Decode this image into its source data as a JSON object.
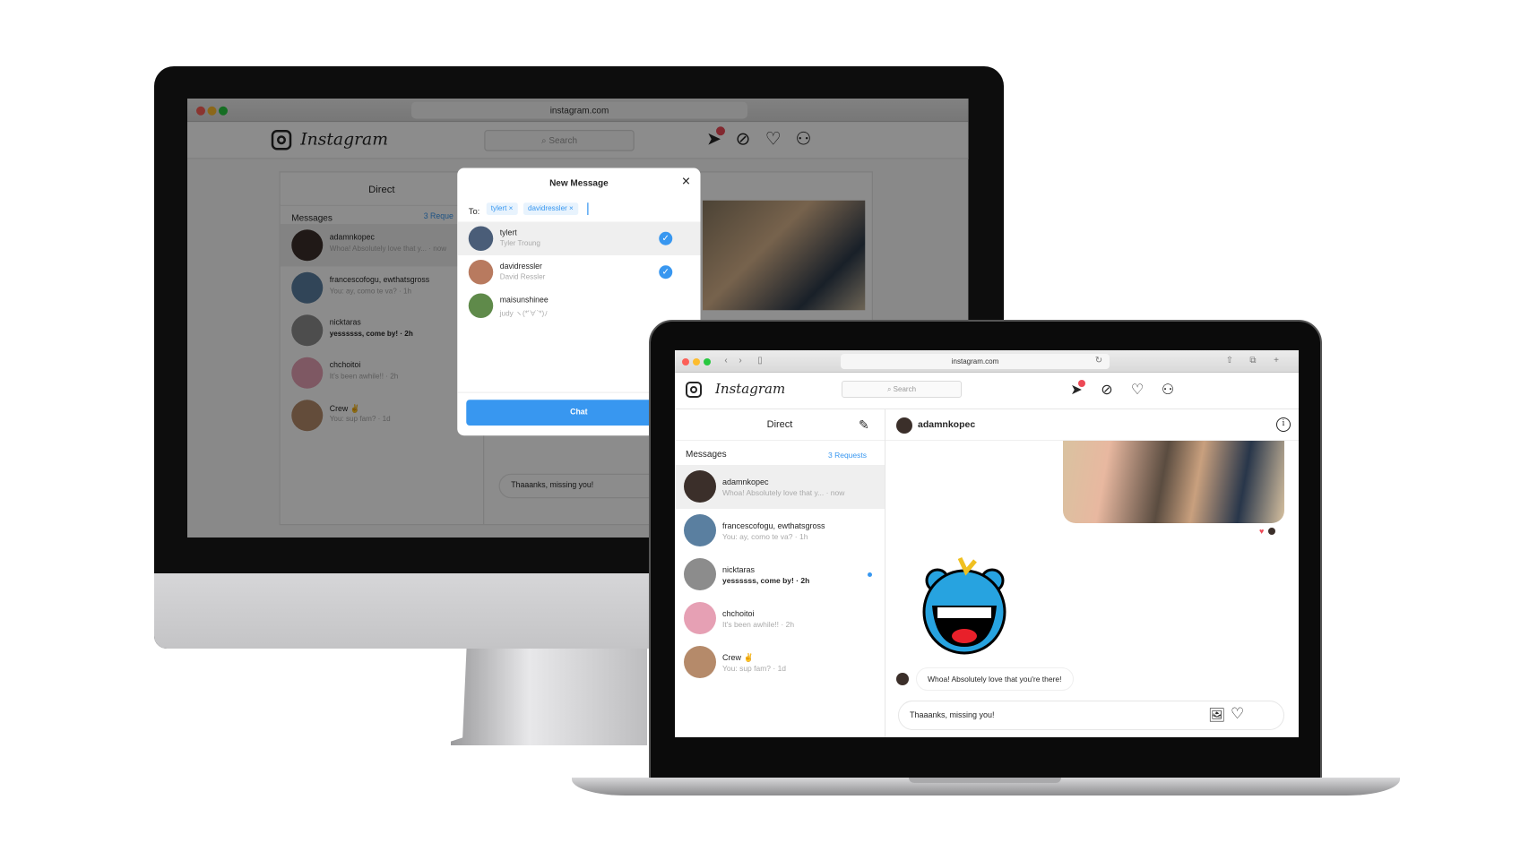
{
  "browser": {
    "url": "instagram.com"
  },
  "app": {
    "wordmark": "Instagram",
    "search_placeholder": "Search",
    "direct_title": "Direct",
    "messages_label": "Messages",
    "requests": "3 Requests",
    "requests_truncated": "3 Reque"
  },
  "threads": [
    {
      "name": "adamnkopec",
      "preview": "Whoa! Absolutely love that y... · now",
      "bold": false,
      "color": "#3b2f2a"
    },
    {
      "name": "francescofogu, ewthatsgross",
      "preview": "You: ay, como te va? · 1h",
      "bold": false,
      "color": "#5a7fa0"
    },
    {
      "name": "nicktaras",
      "preview": "yessssss, come by! · 2h",
      "bold": true,
      "unread": true,
      "color": "#8c8c8c"
    },
    {
      "name": "chchoitoi",
      "preview": "It's been awhile!! · 2h",
      "bold": false,
      "color": "#e6a0b4"
    },
    {
      "name": "Crew ✌",
      "preview": "You: sup fam? · 1d",
      "bold": false,
      "color": "#b58a6a"
    }
  ],
  "chat": {
    "username": "adamnkopec",
    "incoming_message": "Whoa! Absolutely love that you're there!",
    "composer_value": "Thaaanks, missing you!"
  },
  "modal": {
    "title": "New Message",
    "to_label": "To:",
    "chips": [
      "tylert ×",
      "davidressler ×"
    ],
    "suggestions": [
      {
        "username": "tylert",
        "fullname": "Tyler Troung",
        "selected": true,
        "color": "#4a5d78"
      },
      {
        "username": "davidressler",
        "fullname": "David Ressler",
        "selected": true,
        "color": "#b87a5f"
      },
      {
        "username": "maisunshinee",
        "fullname": "judy ヽ(*'∀`*)ﾉ",
        "selected": false,
        "color": "#5f8a4a"
      }
    ],
    "chat_button": "Chat"
  },
  "colors": {
    "accent": "#3897f0",
    "badge": "#ed4956"
  },
  "icons": [
    "direct-icon",
    "compass-icon",
    "heart-icon",
    "profile-icon",
    "compose-icon",
    "info-icon",
    "image-icon",
    "close-icon",
    "check-icon"
  ]
}
